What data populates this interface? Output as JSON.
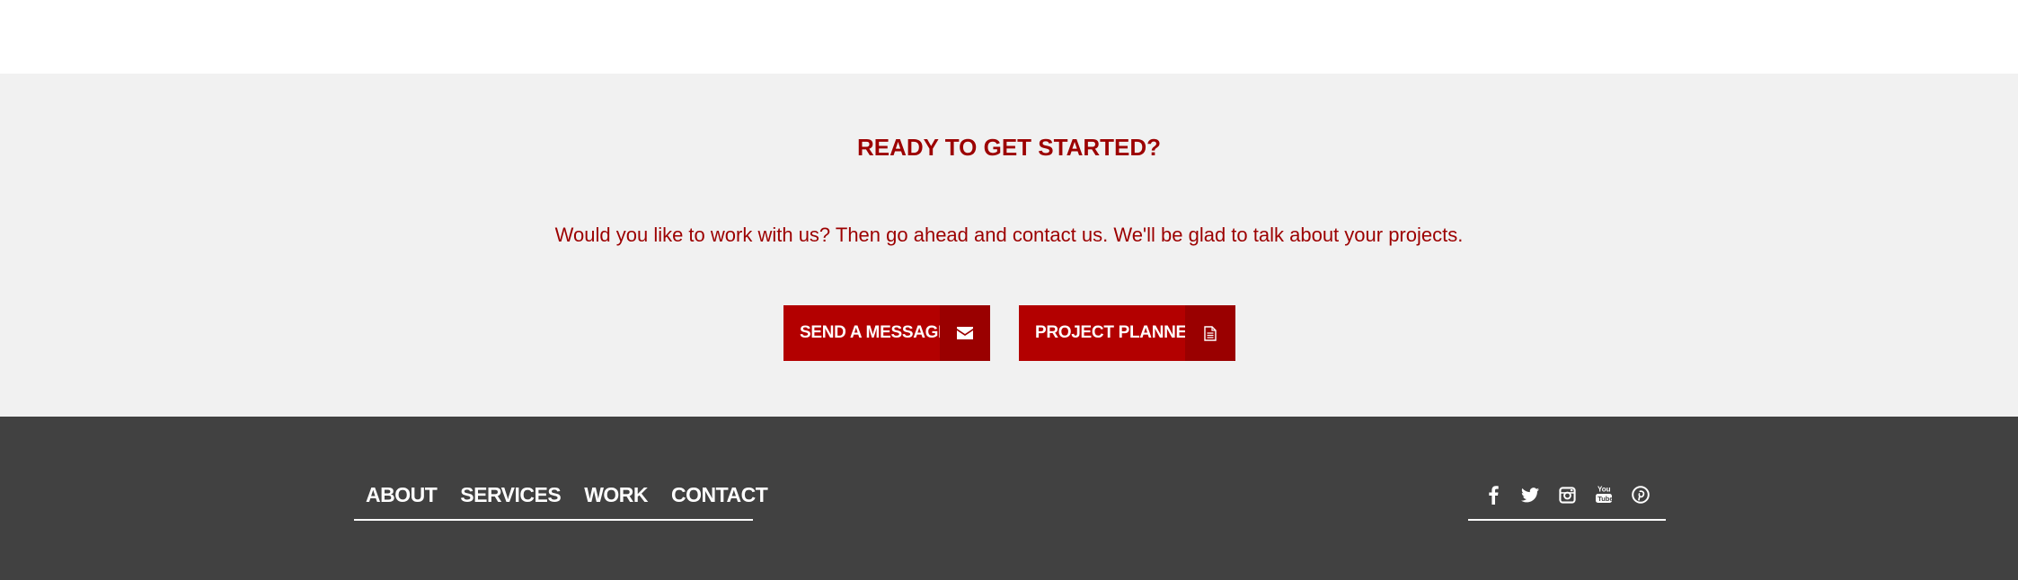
{
  "cta": {
    "title": "READY TO GET STARTED?",
    "text": "Would you like to work with us? Then go ahead and contact us. We'll be glad to talk about your projects.",
    "buttons": [
      {
        "label": "SEND A MESSAGE",
        "icon": "envelope-icon"
      },
      {
        "label": "PROJECT PLANNER",
        "icon": "document-icon"
      }
    ]
  },
  "footer": {
    "nav": [
      {
        "label": "ABOUT"
      },
      {
        "label": "SERVICES"
      },
      {
        "label": "WORK"
      },
      {
        "label": "CONTACT"
      }
    ],
    "social": [
      {
        "icon": "facebook-icon"
      },
      {
        "icon": "twitter-icon"
      },
      {
        "icon": "instagram-icon"
      },
      {
        "icon": "youtube-icon"
      },
      {
        "icon": "pinterest-icon"
      }
    ]
  },
  "colors": {
    "brand_red": "#b30000",
    "brand_red_dark": "#9a0000",
    "heading_red": "#9c0000",
    "cta_background": "#f1f1f1",
    "footer_background": "#414141"
  }
}
